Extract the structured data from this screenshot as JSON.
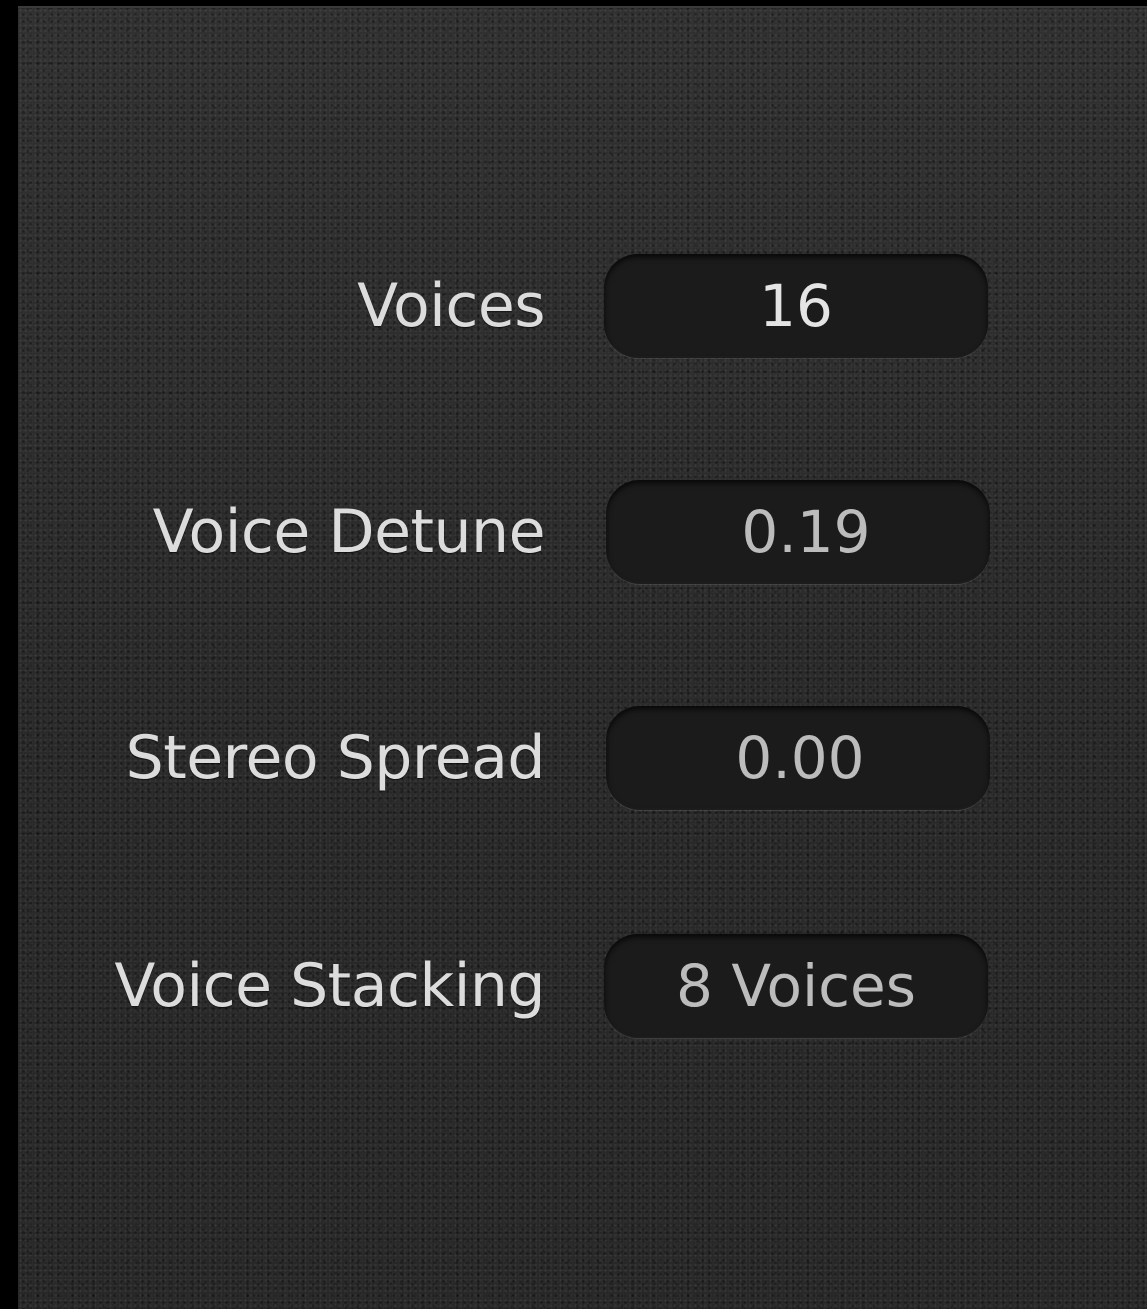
{
  "params": [
    {
      "label": "Voices",
      "value": "16"
    },
    {
      "label": "Voice Detune",
      "value": "0.19"
    },
    {
      "label": "Stereo Spread",
      "value": "0.00"
    },
    {
      "label": "Voice Stacking",
      "value": "8 Voices"
    }
  ]
}
